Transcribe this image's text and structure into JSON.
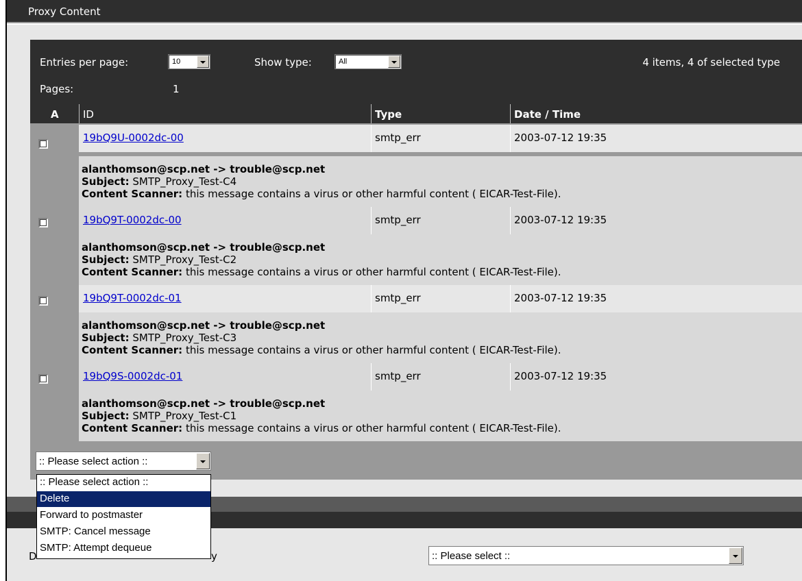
{
  "window": {
    "title": "Proxy Content"
  },
  "toolbar": {
    "entries_label": "Entries per page:",
    "entries_value": "10",
    "show_type_label": "Show type:",
    "show_type_value": "All",
    "summary": "4 items, 4 of selected type",
    "pages_label": "Pages:",
    "pages_value": "1"
  },
  "table": {
    "headers": {
      "a": "A",
      "id": "ID",
      "type": "Type",
      "datetime": "Date / Time"
    },
    "rows": [
      {
        "id": "19bQ9U-0002dc-00",
        "type": "smtp_err",
        "datetime": "2003-07-12 19:35",
        "from_to": "alanthomson@scp.net -> trouble@scp.net",
        "subject": "SMTP_Proxy_Test-C4",
        "scanner": "this message contains a virus or other harmful content ( EICAR-Test-File)."
      },
      {
        "id": "19bQ9T-0002dc-00",
        "type": "smtp_err",
        "datetime": "2003-07-12 19:35",
        "from_to": "alanthomson@scp.net -> trouble@scp.net",
        "subject": "SMTP_Proxy_Test-C2",
        "scanner": "this message contains a virus or other harmful content ( EICAR-Test-File)."
      },
      {
        "id": "19bQ9T-0002dc-01",
        "type": "smtp_err",
        "datetime": "2003-07-12 19:35",
        "from_to": "alanthomson@scp.net -> trouble@scp.net",
        "subject": "SMTP_Proxy_Test-C3",
        "scanner": "this message contains a virus or other harmful content ( EICAR-Test-File)."
      },
      {
        "id": "19bQ9S-0002dc-01",
        "type": "smtp_err",
        "datetime": "2003-07-12 19:35",
        "from_to": "alanthomson@scp.net -> trouble@scp.net",
        "subject": "SMTP_Proxy_Test-C1",
        "scanner": "this message contains a virus or other harmful content ( EICAR-Test-File)."
      }
    ],
    "subject_label": "Subject:",
    "scanner_label": "Content Scanner:"
  },
  "action": {
    "selected": ":: Please select action ::",
    "options": [
      ":: Please select action ::",
      "Delete",
      "Forward to postmaster",
      "SMTP: Cancel message",
      "SMTP: Attempt dequeue"
    ]
  },
  "lower": {
    "left_fragment": "D",
    "right_fragment": "y",
    "select_value": ":: Please select ::"
  },
  "colors": {
    "dark_bar": "#2e2e2e",
    "panel_gray": "#999999",
    "link": "#0000cc",
    "selection": "#0a246a"
  }
}
